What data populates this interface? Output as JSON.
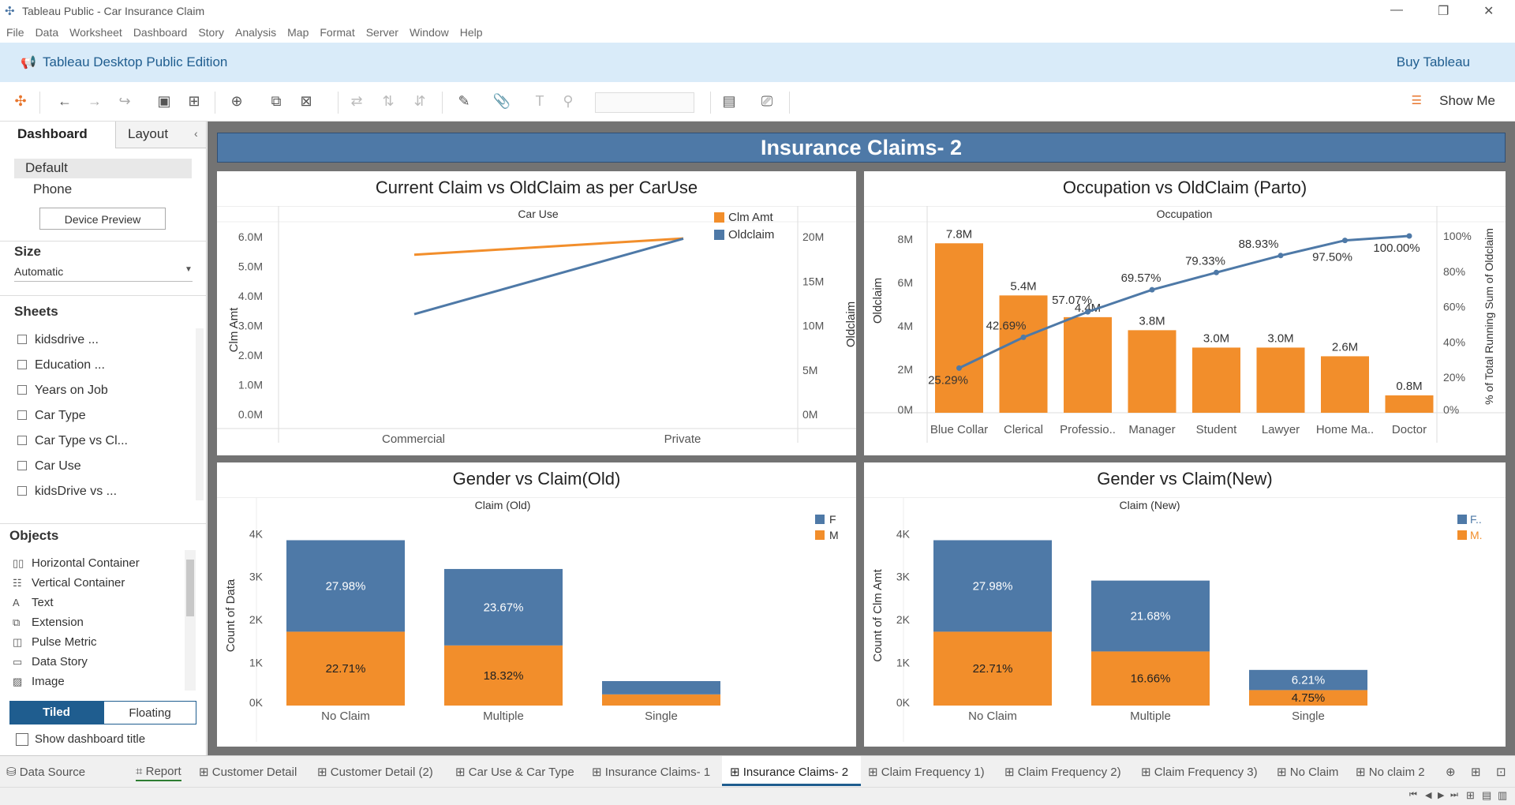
{
  "window": {
    "title": "Tableau Public - Car Insurance Claim"
  },
  "menu": [
    "File",
    "Data",
    "Worksheet",
    "Dashboard",
    "Story",
    "Analysis",
    "Map",
    "Format",
    "Server",
    "Window",
    "Help"
  ],
  "banner": {
    "edition": "Tableau Desktop Public Edition",
    "buy": "Buy Tableau"
  },
  "toolbar": {
    "show_me": "Show Me"
  },
  "left_pane": {
    "tab_dashboard": "Dashboard",
    "tab_layout": "Layout",
    "device_default": "Default",
    "device_phone": "Phone",
    "device_preview": "Device Preview",
    "size_heading": "Size",
    "size_value": "Automatic",
    "sheets_heading": "Sheets",
    "sheets": [
      "kidsdrive ...",
      "Education ...",
      "Years on Job",
      "Car Type",
      "Car Type vs Cl...",
      "Car Use",
      "kidsDrive vs ..."
    ],
    "objects_heading": "Objects",
    "objects": [
      "Horizontal Container",
      "Vertical Container",
      "Text",
      "Extension",
      "Pulse Metric",
      "Data Story",
      "Image"
    ],
    "tiled": "Tiled",
    "floating": "Floating",
    "show_title": "Show dashboard title"
  },
  "dashboard": {
    "title": "Insurance Claims- 2"
  },
  "colors": {
    "orange": "#f28e2b",
    "blue": "#4e79a7",
    "title_bar": "#4e79a7"
  },
  "chart_data": [
    {
      "type": "line",
      "title": "Current Claim vs OldClaim as per CarUse",
      "header": "Car Use",
      "categories": [
        "Commercial",
        "Private"
      ],
      "ylabel_left": "Clm Amt",
      "ylabel_right": "Oldclaim",
      "left_ticks": [
        "6.0M",
        "5.0M",
        "4.0M",
        "3.0M",
        "2.0M",
        "1.0M",
        "0.0M"
      ],
      "right_ticks": [
        "20M",
        "15M",
        "10M",
        "5M",
        "0M"
      ],
      "ylim_left": [
        0,
        6300000
      ],
      "ylim_right": [
        0,
        21000000
      ],
      "series": [
        {
          "name": "Clm Amt",
          "axis": "left",
          "values": [
            5400000,
            5950000
          ]
        },
        {
          "name": "Oldclaim",
          "axis": "right",
          "values": [
            11300000,
            19800000
          ]
        }
      ]
    },
    {
      "type": "bar",
      "title": "Occupation vs OldClaim (Parto)",
      "header": "Occupation",
      "categories": [
        "Blue Collar",
        "Clerical",
        "Professio..",
        "Manager",
        "Student",
        "Lawyer",
        "Home Ma..",
        "Doctor"
      ],
      "values": [
        7800000,
        5400000,
        4400000,
        3800000,
        3000000,
        3000000,
        2600000,
        800000
      ],
      "value_labels": [
        "7.8M",
        "5.4M",
        "4.4M",
        "3.8M",
        "3.0M",
        "3.0M",
        "2.6M",
        "0.8M"
      ],
      "ylabel_left": "Oldclaim",
      "ylabel_right": "% of Total Running Sum of Oldclaim",
      "left_ticks": [
        "8M",
        "6M",
        "4M",
        "2M",
        "0M"
      ],
      "right_ticks": [
        "100%",
        "80%",
        "60%",
        "40%",
        "20%",
        "0%"
      ],
      "ylim_left": [
        0,
        8500000
      ],
      "pareto": [
        25.29,
        42.69,
        57.07,
        69.57,
        79.33,
        88.93,
        97.5,
        100.0
      ],
      "pareto_labels": [
        "25.29%",
        "42.69%",
        "57.07%",
        "69.57%",
        "79.33%",
        "88.93%",
        "97.50%",
        "100.00%"
      ]
    },
    {
      "type": "bar",
      "title": "Gender vs Claim(Old)",
      "header": "Claim (Old)",
      "categories": [
        "No Claim",
        "Multiple",
        "Single"
      ],
      "ylabel": "Count of Data",
      "ticks": [
        "4K",
        "3K",
        "2K",
        "1K",
        "0K"
      ],
      "ylim": [
        0,
        4300
      ],
      "legend": [
        "F",
        "M"
      ],
      "series": [
        {
          "name": "M",
          "values": [
            1720,
            1400,
            260
          ],
          "labels": [
            "22.71%",
            "18.32%",
            ""
          ]
        },
        {
          "name": "F",
          "values": [
            2130,
            1780,
            310
          ],
          "labels": [
            "27.98%",
            "23.67%",
            ""
          ]
        }
      ]
    },
    {
      "type": "bar",
      "title": "Gender vs Claim(New)",
      "header": "Claim (New)",
      "categories": [
        "No Claim",
        "Multiple",
        "Single"
      ],
      "ylabel": "Count of Clm Amt",
      "ticks": [
        "4K",
        "3K",
        "2K",
        "1K",
        "0K"
      ],
      "ylim": [
        0,
        4300
      ],
      "legend": [
        "F..",
        "M."
      ],
      "series": [
        {
          "name": "M.",
          "values": [
            1720,
            1260,
            360
          ],
          "labels": [
            "22.71%",
            "16.66%",
            "4.75%"
          ]
        },
        {
          "name": "F..",
          "values": [
            2130,
            1650,
            470
          ],
          "labels": [
            "27.98%",
            "21.68%",
            "6.21%"
          ]
        }
      ]
    }
  ],
  "sheet_tabs": [
    "Data Source",
    "Report",
    "Customer Detail",
    "Customer Detail (2)",
    "Car Use & Car Type",
    "Insurance Claims- 1",
    "Insurance Claims- 2",
    "Claim Frequency 1)",
    "Claim Frequency 2)",
    "Claim Frequency 3)",
    "No Claim",
    "No claim 2"
  ],
  "active_tab": "Insurance Claims- 2"
}
